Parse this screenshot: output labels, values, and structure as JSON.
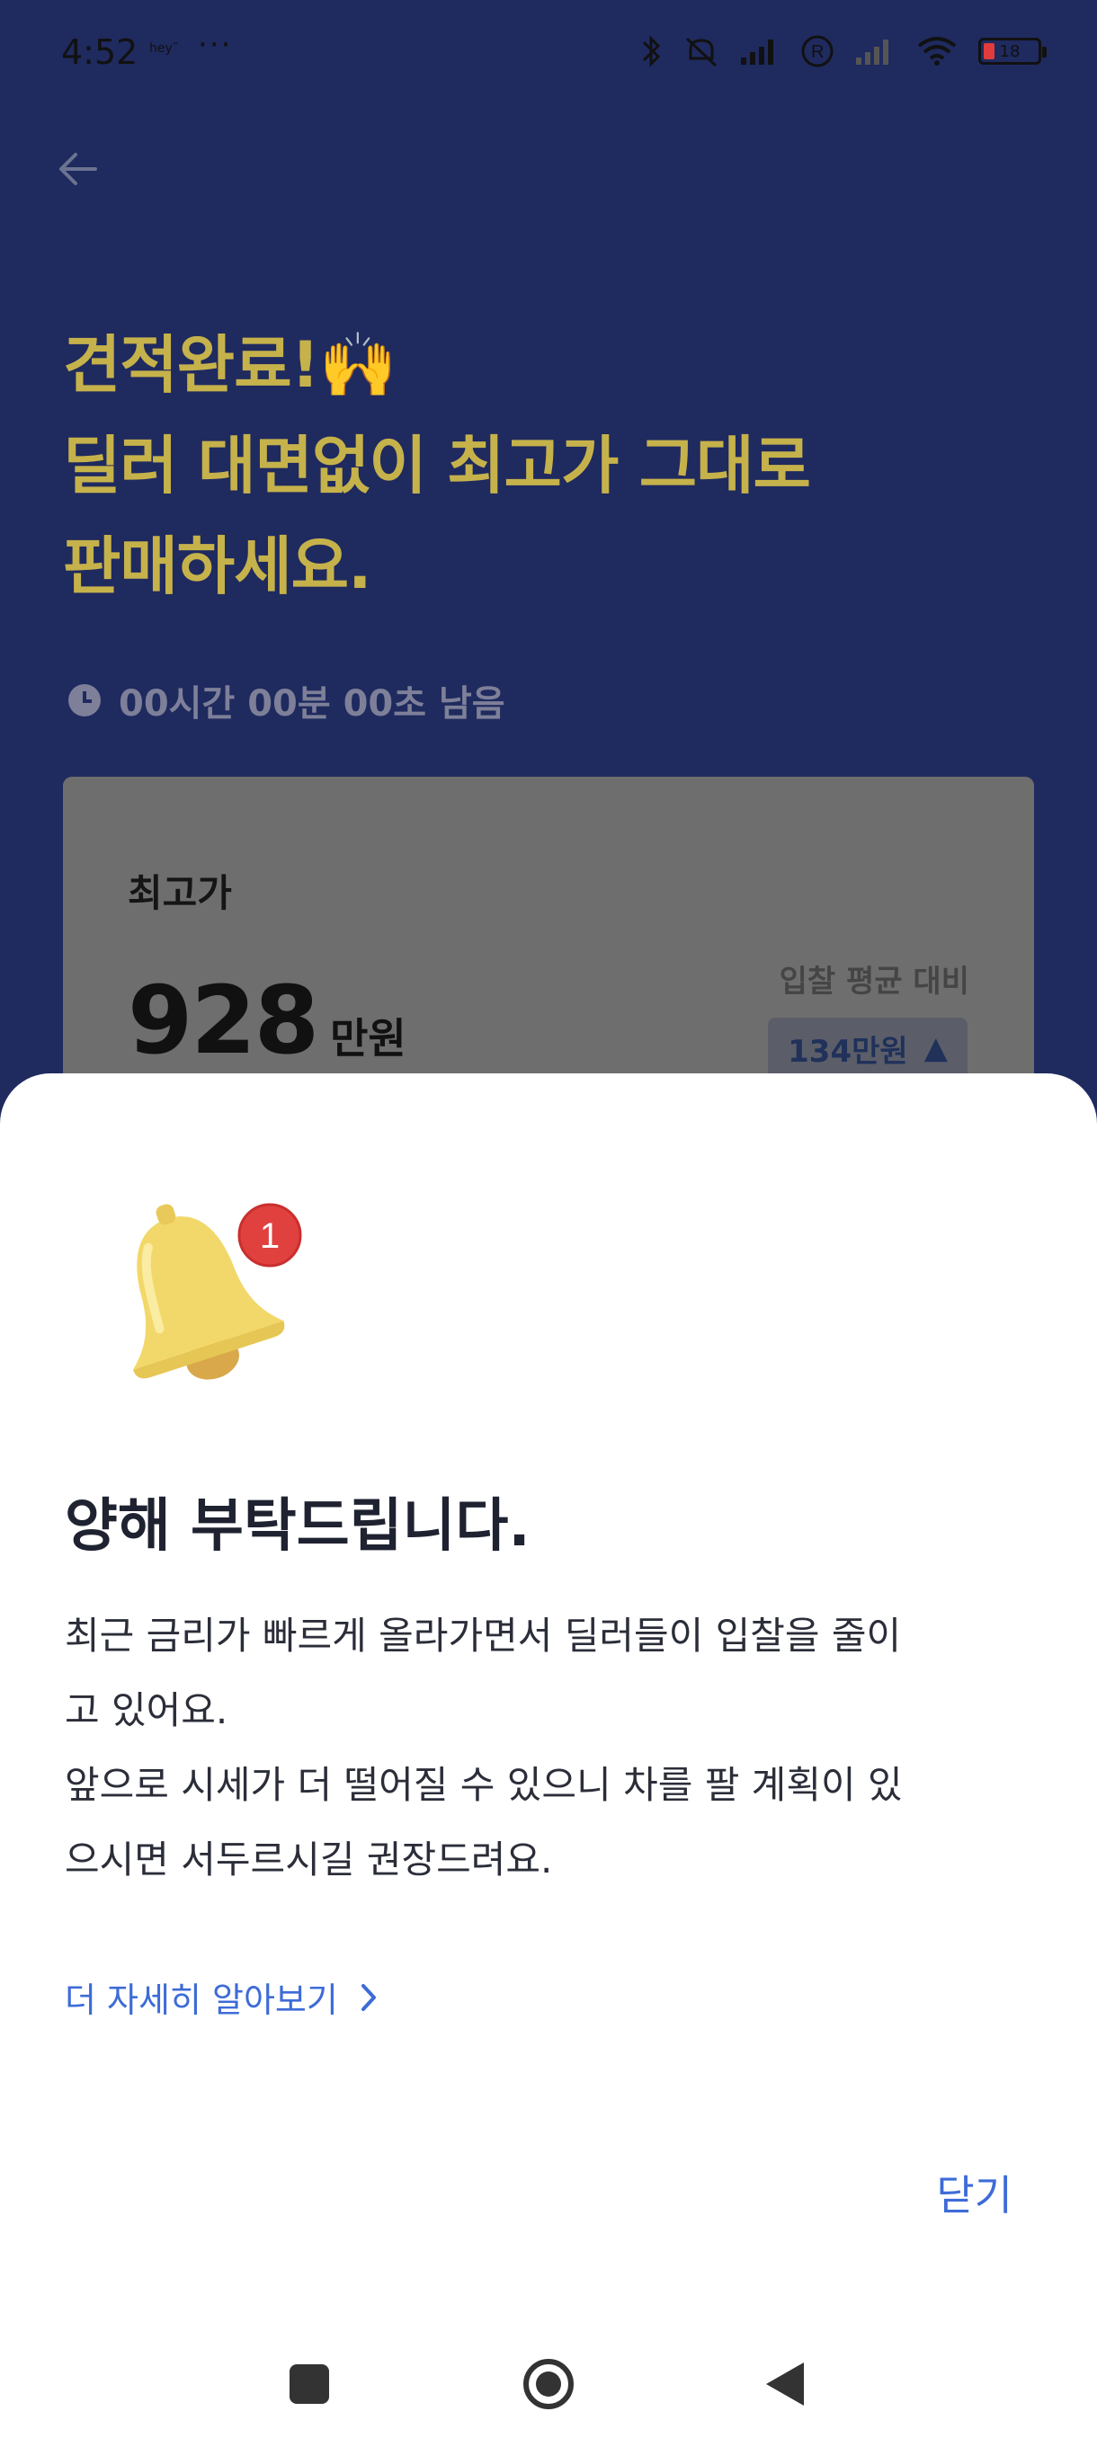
{
  "status_bar": {
    "time": "4:52",
    "small_label": "hey˜",
    "dots": "···",
    "battery_level": "18",
    "icons": [
      "bluetooth-icon",
      "mute-icon",
      "signal-icon",
      "roaming-icon",
      "signal-icon",
      "wifi-icon",
      "battery-icon"
    ]
  },
  "header": {
    "headline_line1": "견적완료!🙌",
    "headline_line2": "딜러 대면없이 최고가 그대로",
    "headline_line3": "판매하세요.",
    "timer_text": "00시간 00분 00초 남음"
  },
  "price_card": {
    "title": "최고가",
    "price_value": "928",
    "price_unit": "만원",
    "compare_label": "입찰 평균 대비",
    "compare_value": "134만원",
    "compare_arrow": "▲"
  },
  "sheet": {
    "title": "양해 부탁드립니다.",
    "body_line1": "최근 금리가 빠르게 올라가면서 딜러들이 입찰을 줄이",
    "body_line2": "고 있어요.",
    "body_line3": "앞으로 시세가 더 떨어질 수 있으니 차를 팔 계획이 있",
    "body_line4": "으시면 서두르시길 권장드려요.",
    "more_link": "더 자세히 알아보기",
    "close_label": "닫기",
    "badge_count": "1"
  },
  "colors": {
    "background_dim": "#1f2a5f",
    "headline": "#c6b24b",
    "link": "#3e6bd8"
  }
}
